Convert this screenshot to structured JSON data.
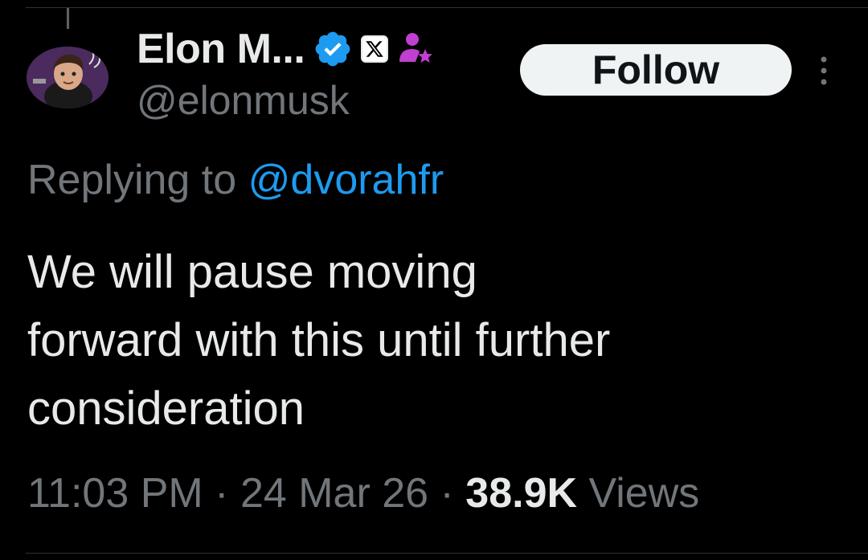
{
  "author": {
    "display_name": "Elon M...",
    "handle": "@elonmusk",
    "icons": [
      "verified-badge-icon",
      "x-affiliate-badge-icon",
      "affiliate-person-star-icon"
    ],
    "verified_color": "#1d9bf0",
    "affiliate_color": "#c13fd1"
  },
  "follow_button": {
    "label": "Follow"
  },
  "reply": {
    "prefix": "Replying to ",
    "mention": "@dvorahfr",
    "mention_color": "#1d9bf0"
  },
  "tweet": {
    "text": "We will pause moving\nforward with this until further\nconsideration"
  },
  "meta": {
    "time": "11:03 PM",
    "sep1": " · ",
    "date": "24 Mar 26",
    "sep2": " · ",
    "views_count": "38.9K",
    "views_label": " Views"
  },
  "x_badge_glyph": "𝕏"
}
